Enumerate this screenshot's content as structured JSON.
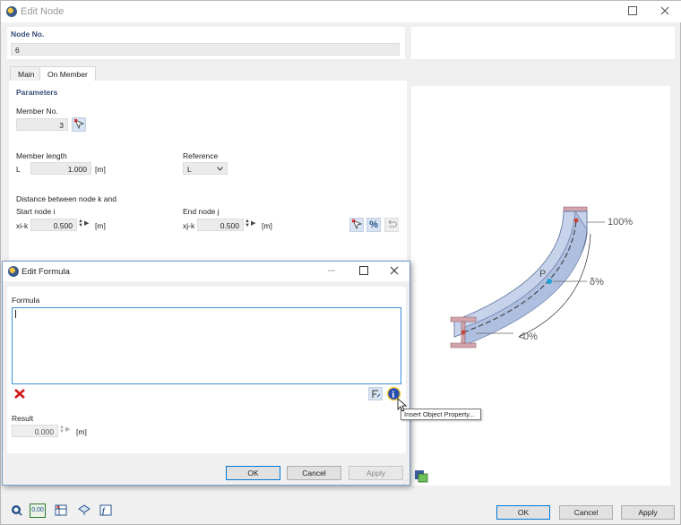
{
  "window": {
    "title": "Edit Node"
  },
  "node": {
    "label": "Node No.",
    "value": "6"
  },
  "tabs": [
    {
      "label": "Main"
    },
    {
      "label": "On Member"
    }
  ],
  "parameters": {
    "heading": "Parameters",
    "member_no_label": "Member No.",
    "member_no_value": "3",
    "member_length_label": "Member length",
    "length_symbol": "L",
    "length_value": "1.000",
    "length_unit": "[m]",
    "reference_label": "Reference",
    "reference_value": "L",
    "distance_label": "Distance between node k and",
    "start_node_label": "Start node i",
    "start_symbol": "xi-k",
    "start_value": "0.500",
    "start_unit": "[m]",
    "end_node_label": "End node j",
    "end_symbol": "xj-k",
    "end_value": "0.500",
    "end_unit": "[m]",
    "percent_label": "%"
  },
  "diagram": {
    "label_100": "100%",
    "label_delta": "δ%",
    "label_0": "0%",
    "label_p": "P"
  },
  "formula_dialog": {
    "title": "Edit Formula",
    "formula_label": "Formula",
    "formula_value": "",
    "result_label": "Result",
    "result_value": "0.000",
    "result_unit": "[m]",
    "ok_label": "OK",
    "cancel_label": "Cancel",
    "apply_label": "Apply",
    "tooltip": "Insert Object Property..."
  },
  "footer": {
    "ok_label": "OK",
    "cancel_label": "Cancel",
    "apply_label": "Apply",
    "coord_label": "0.00"
  }
}
